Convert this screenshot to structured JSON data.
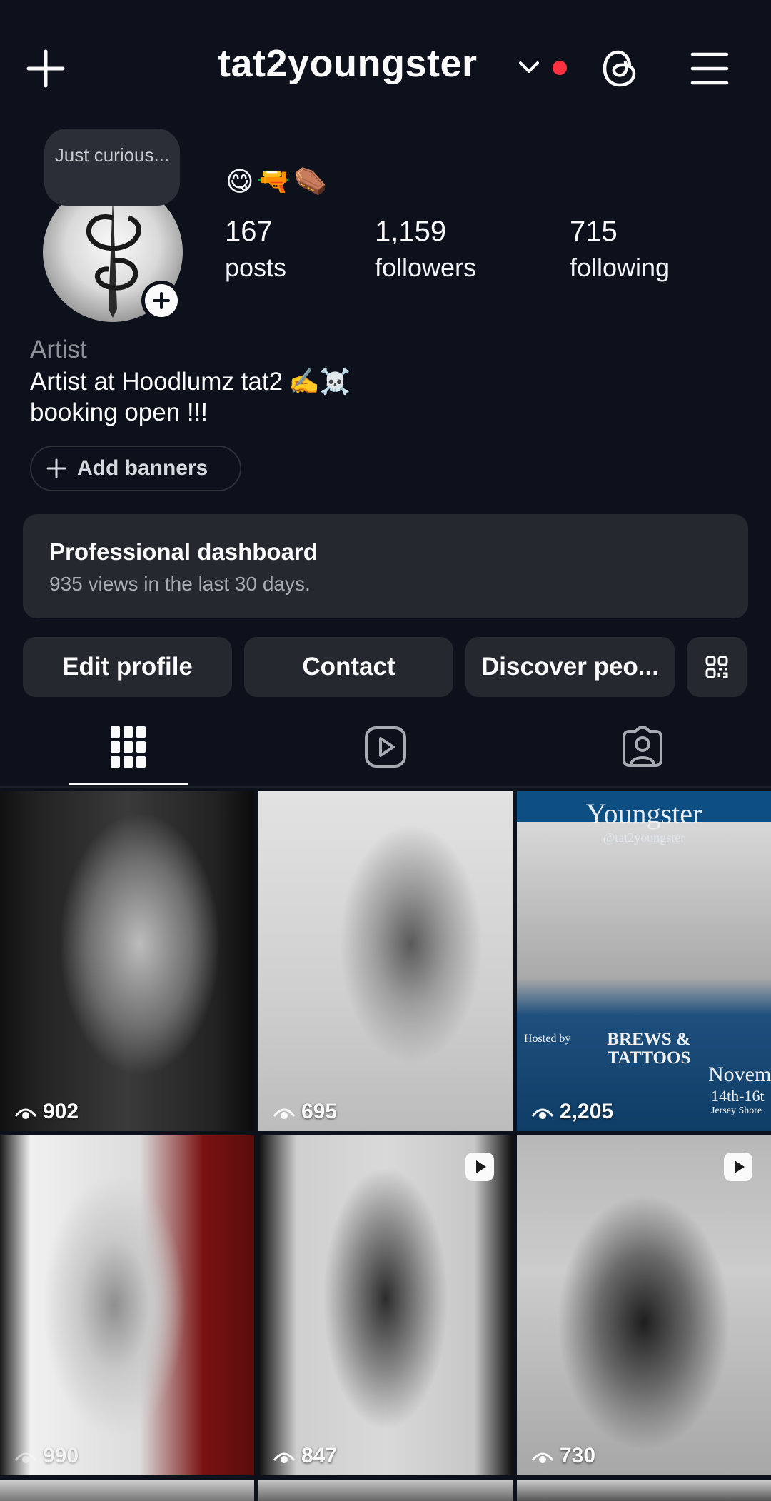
{
  "topbar": {
    "username": "tat2youngster"
  },
  "profile": {
    "note": "Just curious...",
    "emojis": [
      "😋",
      "🔫",
      "⚰️"
    ],
    "stats": [
      {
        "value": "167",
        "label": "posts"
      },
      {
        "value": "1,159",
        "label": "followers"
      },
      {
        "value": "715",
        "label": "following"
      }
    ],
    "category": "Artist",
    "bio_line1": "Artist at Hoodlumz tat2",
    "bio_line1_emojis": "✍️☠️",
    "bio_line2": "booking open !!!",
    "add_banners_label": "Add banners"
  },
  "dashboard": {
    "title": "Professional dashboard",
    "subtitle": "935 views in the last 30 days."
  },
  "actions": {
    "edit_profile": "Edit profile",
    "contact": "Contact",
    "discover": "Discover peo..."
  },
  "tabs": [
    "grid",
    "reels",
    "tagged"
  ],
  "grid": {
    "tiles": [
      {
        "views": "902",
        "reel": false
      },
      {
        "views": "695",
        "reel": false
      },
      {
        "views": "2,205",
        "reel": false
      },
      {
        "views": "990",
        "reel": false
      },
      {
        "views": "847",
        "reel": true
      },
      {
        "views": "730",
        "reel": true
      }
    ],
    "tile3_heading": "Youngster",
    "tile3_handle": "@tat2youngster",
    "tile3_event": "BREWS & TATTOOS",
    "tile3_month": "Novemb",
    "tile3_dates": "14th-16t",
    "tile3_place": "Jersey Shore",
    "tile3_hosted": "Hosted by"
  },
  "colors": {
    "background": "#0c111b",
    "surface": "#25292f",
    "notification_dot": "#ff3040",
    "secondary_text": "#8e9298"
  }
}
